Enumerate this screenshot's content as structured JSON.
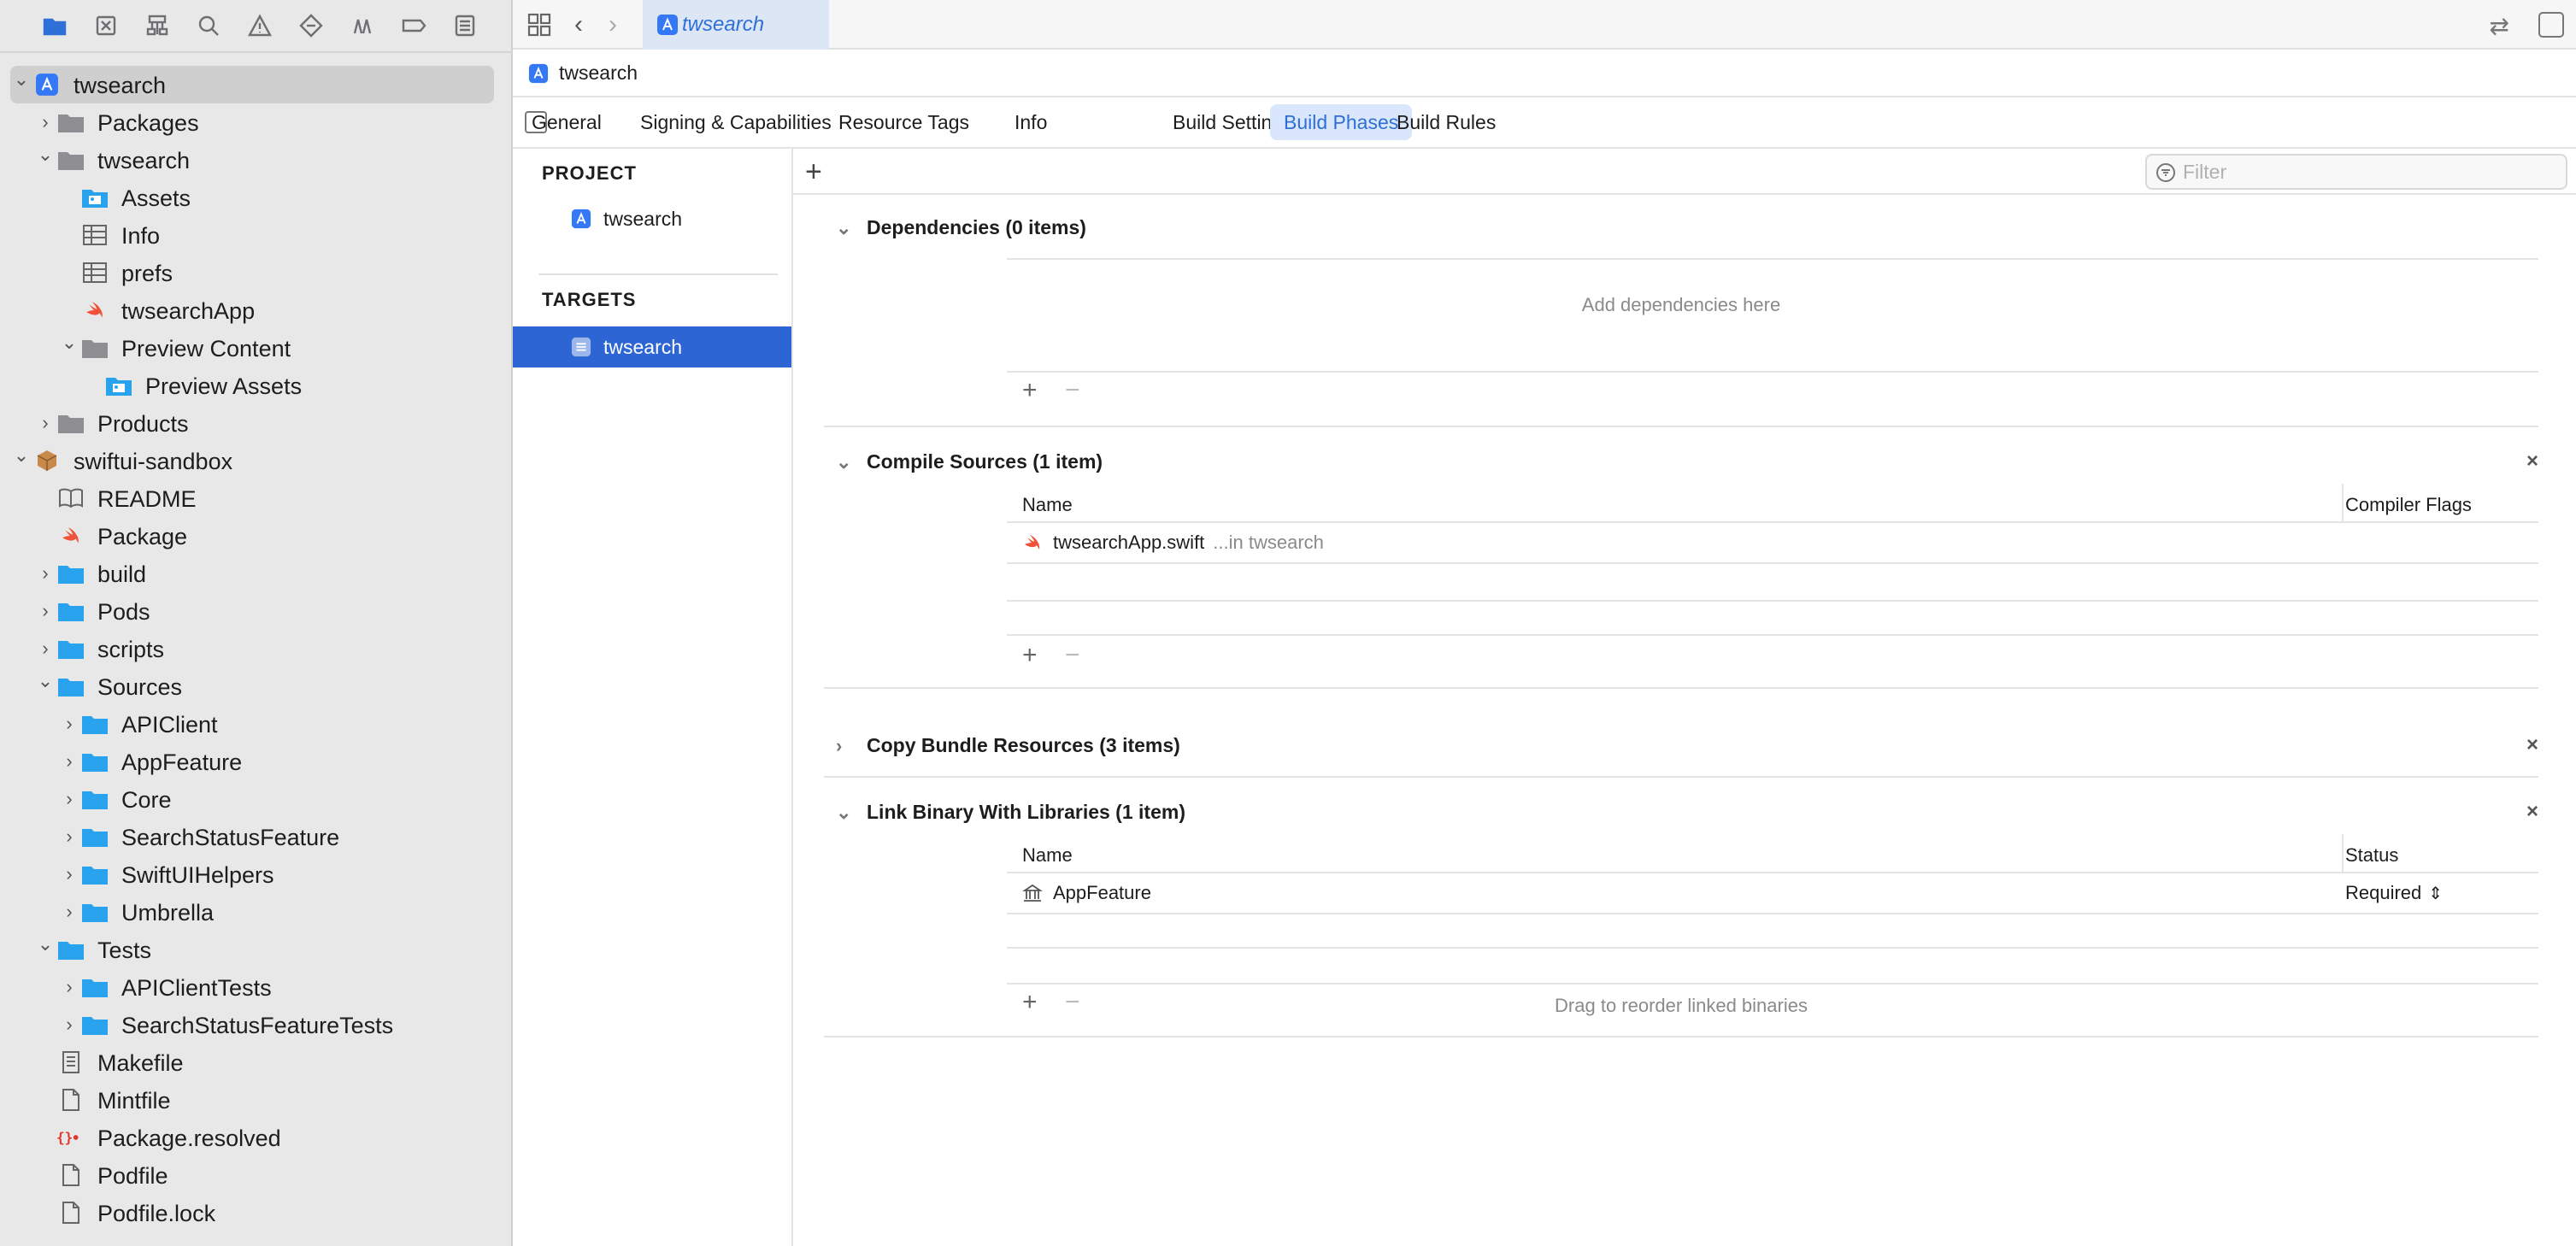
{
  "navigator": {
    "toolbar_icons": [
      "folder-icon",
      "source-control-icon",
      "hierarchy-icon",
      "search-icon",
      "issue-warning-icon",
      "test-diamond-icon",
      "debug-icon",
      "breakpoint-icon",
      "report-icon"
    ],
    "tree": [
      {
        "label": "twsearch",
        "indent": 0,
        "chev": "down",
        "icon": "app-project",
        "selected": true
      },
      {
        "label": "Packages",
        "indent": 1,
        "chev": "right",
        "icon": "gray-folder"
      },
      {
        "label": "twsearch",
        "indent": 1,
        "chev": "down",
        "icon": "gray-folder"
      },
      {
        "label": "Assets",
        "indent": 2,
        "chev": "",
        "icon": "assets"
      },
      {
        "label": "Info",
        "indent": 2,
        "chev": "",
        "icon": "table"
      },
      {
        "label": "prefs",
        "indent": 2,
        "chev": "",
        "icon": "table"
      },
      {
        "label": "twsearchApp",
        "indent": 2,
        "chev": "",
        "icon": "swift"
      },
      {
        "label": "Preview Content",
        "indent": 2,
        "chev": "down",
        "icon": "gray-folder"
      },
      {
        "label": "Preview Assets",
        "indent": 3,
        "chev": "",
        "icon": "assets"
      },
      {
        "label": "Products",
        "indent": 1,
        "chev": "right",
        "icon": "gray-folder"
      },
      {
        "label": "swiftui-sandbox",
        "indent": 0,
        "chev": "down",
        "icon": "package"
      },
      {
        "label": "README",
        "indent": 1,
        "chev": "",
        "icon": "book"
      },
      {
        "label": "Package",
        "indent": 1,
        "chev": "",
        "icon": "swift"
      },
      {
        "label": "build",
        "indent": 1,
        "chev": "right",
        "icon": "blue-folder"
      },
      {
        "label": "Pods",
        "indent": 1,
        "chev": "right",
        "icon": "blue-folder"
      },
      {
        "label": "scripts",
        "indent": 1,
        "chev": "right",
        "icon": "blue-folder"
      },
      {
        "label": "Sources",
        "indent": 1,
        "chev": "down",
        "icon": "blue-folder"
      },
      {
        "label": "APIClient",
        "indent": 2,
        "chev": "right",
        "icon": "blue-folder"
      },
      {
        "label": "AppFeature",
        "indent": 2,
        "chev": "right",
        "icon": "blue-folder"
      },
      {
        "label": "Core",
        "indent": 2,
        "chev": "right",
        "icon": "blue-folder"
      },
      {
        "label": "SearchStatusFeature",
        "indent": 2,
        "chev": "right",
        "icon": "blue-folder"
      },
      {
        "label": "SwiftUIHelpers",
        "indent": 2,
        "chev": "right",
        "icon": "blue-folder"
      },
      {
        "label": "Umbrella",
        "indent": 2,
        "chev": "right",
        "icon": "blue-folder"
      },
      {
        "label": "Tests",
        "indent": 1,
        "chev": "down",
        "icon": "blue-folder"
      },
      {
        "label": "APIClientTests",
        "indent": 2,
        "chev": "right",
        "icon": "blue-folder"
      },
      {
        "label": "SearchStatusFeatureTests",
        "indent": 2,
        "chev": "right",
        "icon": "blue-folder"
      },
      {
        "label": "Makefile",
        "indent": 1,
        "chev": "",
        "icon": "doc-lines"
      },
      {
        "label": "Mintfile",
        "indent": 1,
        "chev": "",
        "icon": "doc"
      },
      {
        "label": "Package.resolved",
        "indent": 1,
        "chev": "",
        "icon": "json"
      },
      {
        "label": "Podfile",
        "indent": 1,
        "chev": "",
        "icon": "doc"
      },
      {
        "label": "Podfile.lock",
        "indent": 1,
        "chev": "",
        "icon": "doc"
      }
    ]
  },
  "tabbar": {
    "doc_tab": "twsearch"
  },
  "jumpbar": {
    "label": "twsearch"
  },
  "editor_tabs": [
    "General",
    "Signing & Capabilities",
    "Resource Tags",
    "Info",
    "Build Settings",
    "Build Phases",
    "Build Rules"
  ],
  "active_editor_tab": "Build Phases",
  "targets_panel": {
    "project_header": "PROJECT",
    "project_item": "twsearch",
    "targets_header": "TARGETS",
    "target_item": "twsearch"
  },
  "phases": {
    "filter_placeholder": "Filter",
    "dependencies": {
      "title": "Dependencies (0 items)",
      "empty": "Add dependencies here"
    },
    "compile": {
      "title": "Compile Sources (1 item)",
      "col_name": "Name",
      "col_flags": "Compiler Flags",
      "file": "twsearchApp.swift",
      "location": "...in twsearch"
    },
    "copy": {
      "title": "Copy Bundle Resources (3 items)"
    },
    "link": {
      "title": "Link Binary With Libraries (1 item)",
      "col_name": "Name",
      "col_status": "Status",
      "lib": "AppFeature",
      "status": "Required",
      "hint": "Drag to reorder linked binaries"
    }
  },
  "colors": {
    "accent": "#2f6fd8",
    "selection": "#2e65d4",
    "swift": "#f05138",
    "json": "#e0392b"
  }
}
